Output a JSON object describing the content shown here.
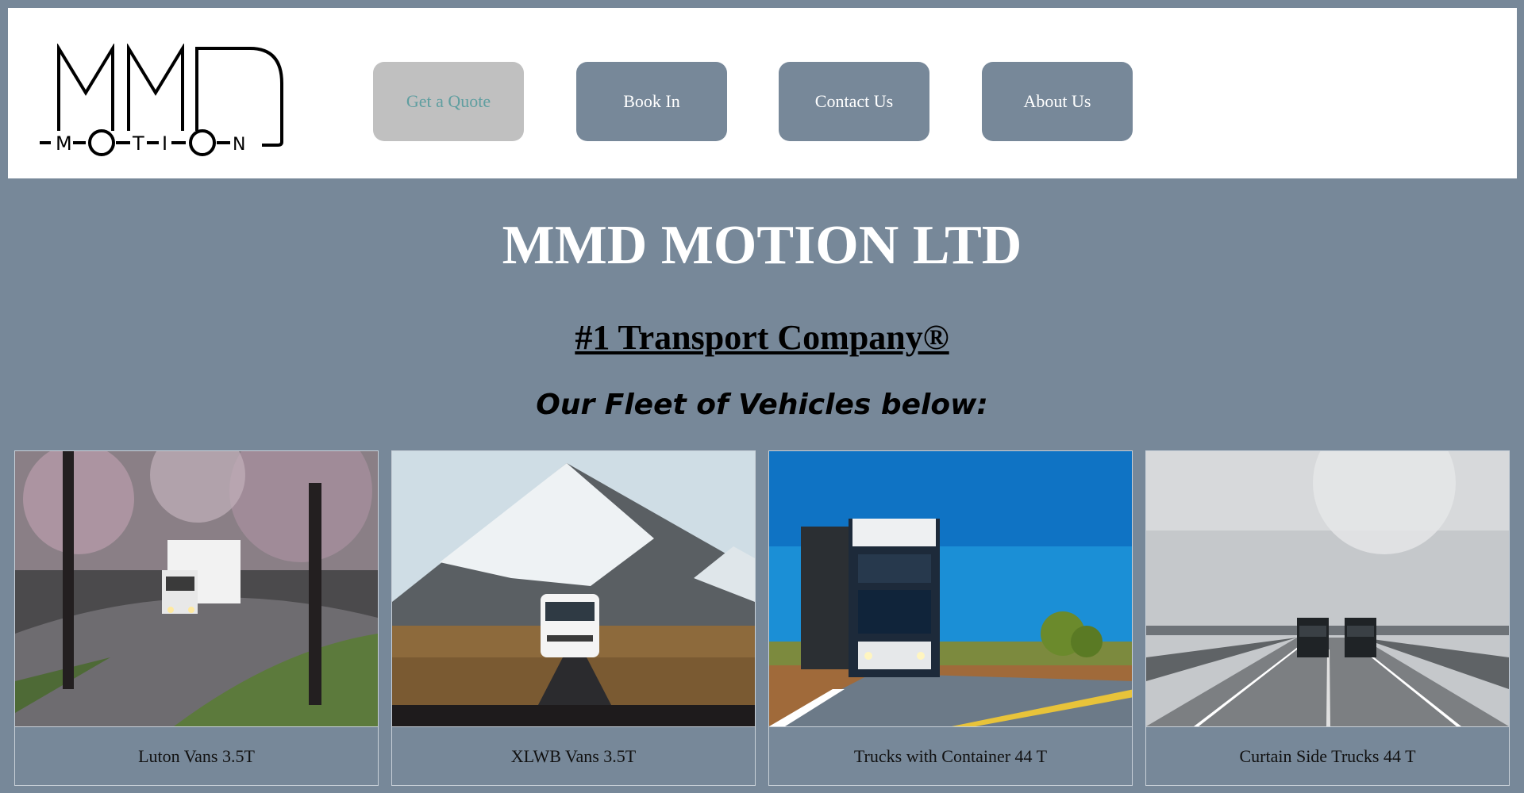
{
  "header": {
    "logo": {
      "big_text": "MMD",
      "small_text": "MOTION"
    },
    "nav": [
      {
        "label": "Get a Quote",
        "active": true
      },
      {
        "label": "Book In",
        "active": false
      },
      {
        "label": "Contact Us",
        "active": false
      },
      {
        "label": "About Us",
        "active": false
      }
    ]
  },
  "main": {
    "title": "MMD MOTION LTD",
    "subtitle": "#1 Transport Company®",
    "fleet_heading": "Our Fleet of Vehicles below:"
  },
  "fleet": [
    {
      "caption": "Luton Vans 3.5T",
      "image": "luton-van-photo"
    },
    {
      "caption": "XLWB Vans 3.5T",
      "image": "xlwb-van-photo"
    },
    {
      "caption": "Trucks with Container 44 T",
      "image": "container-truck-photo"
    },
    {
      "caption": "Curtain Side Trucks 44 T",
      "image": "curtain-side-trucks-photo"
    }
  ],
  "colors": {
    "background": "#778899",
    "header_bg": "#ffffff",
    "button_bg": "#778899",
    "button_active_bg": "#c0c0c0",
    "button_active_text": "#5f9ea0"
  }
}
